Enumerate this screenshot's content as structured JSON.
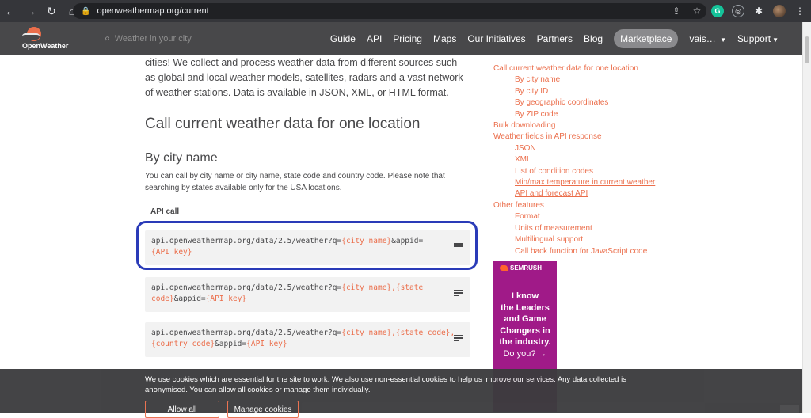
{
  "browser": {
    "url": "openweathermap.org/current"
  },
  "navbar": {
    "logo_text": "OpenWeather",
    "search_placeholder": "Weather in your city",
    "items": [
      "Guide",
      "API",
      "Pricing",
      "Maps",
      "Our Initiatives",
      "Partners",
      "Blog"
    ],
    "marketplace": "Marketplace",
    "user": "vais…",
    "support": "Support"
  },
  "main": {
    "intro": "cities! We collect and process weather data from different sources such as global and local weather models, satellites, radars and a vast network of weather stations. Data is available in JSON, XML, or HTML format.",
    "heading": "Call current weather data for one location",
    "subheading": "By city name",
    "description": "You can call by city name or city name, state code and country code. Please note that searching by states available only for the USA locations.",
    "api_call_label": "API call",
    "code_blocks": [
      {
        "a": "api.openweathermap.org/data/2.5/weather?q=",
        "b": "{city name}",
        "c": "&appid=",
        "d": "{API key}"
      },
      {
        "a": "api.openweathermap.org/data/2.5/weather?q=",
        "b": "{city name},{state code}",
        "c": "&appid=",
        "d": "{API key}"
      },
      {
        "a": "api.openweathermap.org/data/2.5/weather?q=",
        "b": "{city name},{state code},{country code}",
        "c": "&appid=",
        "d": "{API key}"
      }
    ]
  },
  "sidebar": {
    "items": [
      {
        "label": "Call current weather data for one location",
        "indent": false,
        "underline": false
      },
      {
        "label": "By city name",
        "indent": true,
        "underline": false
      },
      {
        "label": "By city ID",
        "indent": true,
        "underline": false
      },
      {
        "label": "By geographic coordinates",
        "indent": true,
        "underline": false
      },
      {
        "label": "By ZIP code",
        "indent": true,
        "underline": false
      },
      {
        "label": "Bulk downloading",
        "indent": false,
        "underline": false
      },
      {
        "label": "Weather fields in API response",
        "indent": false,
        "underline": false
      },
      {
        "label": "JSON",
        "indent": true,
        "underline": false
      },
      {
        "label": "XML",
        "indent": true,
        "underline": false
      },
      {
        "label": "List of condition codes",
        "indent": true,
        "underline": false
      },
      {
        "label": "Min/max temperature in current weather",
        "indent": true,
        "underline": true
      },
      {
        "label": "API and forecast API",
        "indent": true,
        "underline": true
      },
      {
        "label": "Other features",
        "indent": false,
        "underline": false
      },
      {
        "label": "Format",
        "indent": true,
        "underline": false
      },
      {
        "label": "Units of measurement",
        "indent": true,
        "underline": false
      },
      {
        "label": "Multilingual support",
        "indent": true,
        "underline": false
      },
      {
        "label": "Call back function for JavaScript code",
        "indent": true,
        "underline": false
      }
    ]
  },
  "ad": {
    "brand": "SEMRUSH",
    "lines": [
      "I know",
      "the Leaders",
      "and Game",
      "Changers in",
      "the industry."
    ],
    "question": "Do you? →"
  },
  "cookie": {
    "message": "We use cookies which are essential for the site to work. We also use non-essential cookies to help us improve our services. Any data collected is anonymised. You can allow all cookies or manage them individually.",
    "allow_all": "Allow all",
    "manage": "Manage cookies"
  },
  "colors": {
    "accent": "#eb6e4b",
    "navbar": "#48484a",
    "highlight": "#2a3bb8",
    "ad_bg": "#a01a88"
  }
}
